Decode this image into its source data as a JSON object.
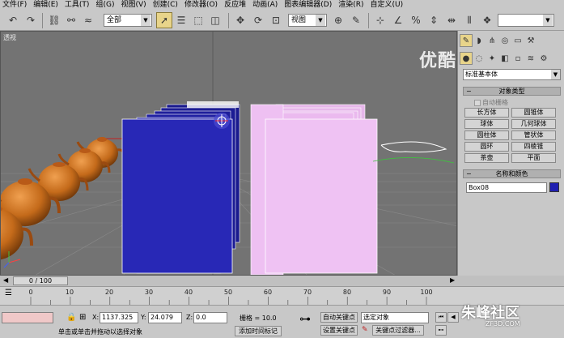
{
  "menu": [
    "文件(F)",
    "编辑(E)",
    "工具(T)",
    "组(G)",
    "视图(V)",
    "创建(C)",
    "修改器(O)",
    "反应堆",
    "动画(A)",
    "图表编辑器(D)",
    "渲染(R)",
    "自定义(U)"
  ],
  "toolbar": {
    "selection_filter": "全部",
    "ref_coord": "视图"
  },
  "viewport": {
    "label": "透视",
    "watermark": "优酷"
  },
  "command_panel": {
    "category": "标准基本体",
    "object_type_title": "对象类型",
    "autogrid_label": "自动栅格",
    "buttons": [
      "长方体",
      "圆锥体",
      "球体",
      "几何球体",
      "圆柱体",
      "管状体",
      "圆环",
      "四棱锥",
      "茶壶",
      "平面"
    ],
    "name_color_title": "名称和颜色",
    "object_name": "Box08",
    "object_color": "#1f1fb0"
  },
  "timeline": {
    "frame_display": "0 / 100",
    "ticks": [
      "0",
      "10",
      "20",
      "30",
      "40",
      "50",
      "60",
      "70",
      "80",
      "90",
      "100"
    ]
  },
  "status": {
    "x_label": "X:",
    "x_value": "1137.325",
    "y_label": "Y:",
    "y_value": "24.079",
    "z_label": "Z:",
    "z_value": "0.0",
    "grid": "栅格 = 10.0",
    "prompt": "单击或单击并拖动以选择对象",
    "add_time_tag": "添加时间标记",
    "auto_key": "自动关键点",
    "set_key": "设置关键点",
    "selected_object": "选定对象",
    "key_filters": "关键点过滤器..."
  },
  "watermark": {
    "brand": "朱峰社区",
    "sub": "ZF3D.COM"
  }
}
